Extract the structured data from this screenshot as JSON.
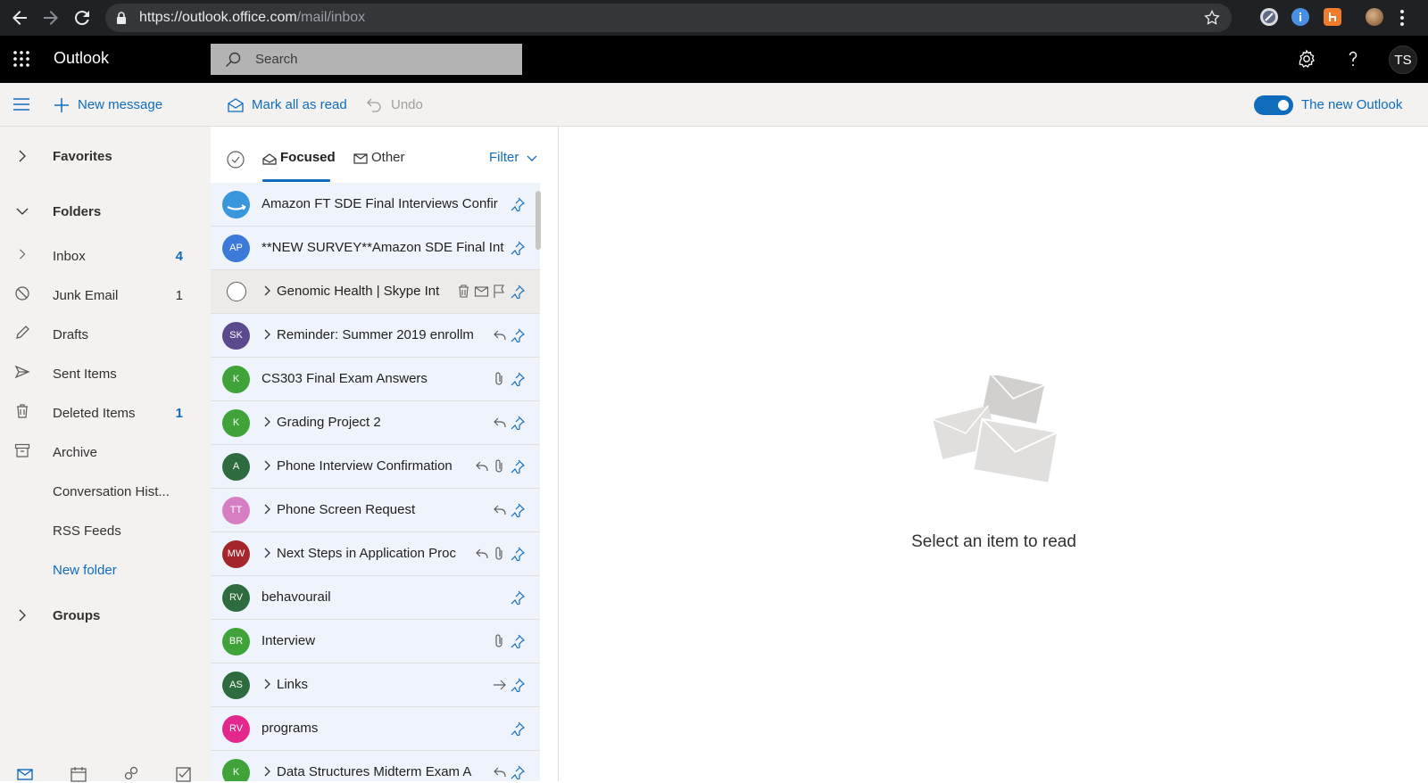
{
  "browser": {
    "url_host": "https://outlook.office.com",
    "url_path": "/mail/inbox"
  },
  "header": {
    "brand": "Outlook",
    "search_placeholder": "Search",
    "user_initials": "TS"
  },
  "commandbar": {
    "new_message": "New message",
    "mark_all_read": "Mark all as read",
    "undo": "Undo",
    "new_outlook_label": "The new Outlook",
    "new_outlook_on": true
  },
  "nav": {
    "favorites": "Favorites",
    "folders": "Folders",
    "items": [
      {
        "label": "Inbox",
        "count": "4"
      },
      {
        "label": "Junk Email",
        "count": "1"
      },
      {
        "label": "Drafts",
        "count": ""
      },
      {
        "label": "Sent Items",
        "count": ""
      },
      {
        "label": "Deleted Items",
        "count": "1"
      },
      {
        "label": "Archive",
        "count": ""
      },
      {
        "label": "Conversation Hist...",
        "count": ""
      },
      {
        "label": "RSS Feeds",
        "count": ""
      }
    ],
    "new_folder": "New folder",
    "groups": "Groups"
  },
  "list": {
    "tabs": [
      "Focused",
      "Other"
    ],
    "active_tab": "Focused",
    "filter": "Filter",
    "messages": [
      {
        "avatar": "",
        "avatar_color": "#3a96dd",
        "avatar_icon": "amazon-logo",
        "subject": "Amazon FT SDE Final Interviews Confir",
        "thread": false,
        "icons": [
          "pin"
        ]
      },
      {
        "avatar": "AP",
        "avatar_color": "#3c7ad9",
        "subject": "**NEW SURVEY**Amazon SDE Final Int",
        "thread": false,
        "icons": [
          "pin"
        ]
      },
      {
        "avatar": "",
        "avatar_color": "",
        "subject": "Genomic Health | Skype Int",
        "thread": true,
        "hover": true,
        "icons": [
          "delete",
          "mark-read",
          "flag",
          "pin"
        ]
      },
      {
        "avatar": "SK",
        "avatar_color": "#5c4a8f",
        "subject": "Reminder: Summer 2019 enrollm",
        "thread": true,
        "icons": [
          "reply",
          "pin"
        ]
      },
      {
        "avatar": "K",
        "avatar_color": "#3fa33a",
        "subject": "CS303 Final Exam Answers",
        "thread": false,
        "icons": [
          "attachment",
          "pin"
        ]
      },
      {
        "avatar": "K",
        "avatar_color": "#3fa33a",
        "subject": "Grading Project 2",
        "thread": true,
        "icons": [
          "reply",
          "pin"
        ]
      },
      {
        "avatar": "A",
        "avatar_color": "#2e6b3e",
        "subject": "Phone Interview Confirmation",
        "thread": true,
        "icons": [
          "reply",
          "attachment",
          "pin"
        ]
      },
      {
        "avatar": "TT",
        "avatar_color": "#d67ec4",
        "subject": "Phone Screen Request",
        "thread": true,
        "icons": [
          "reply",
          "pin"
        ]
      },
      {
        "avatar": "MW",
        "avatar_color": "#a4262c",
        "subject": "Next Steps in Application Proc",
        "thread": true,
        "icons": [
          "reply",
          "attachment",
          "pin"
        ]
      },
      {
        "avatar": "RV",
        "avatar_color": "#2e6b3e",
        "subject": "behavourail",
        "thread": false,
        "icons": [
          "pin"
        ]
      },
      {
        "avatar": "BR",
        "avatar_color": "#3fa33a",
        "subject": "Interview",
        "thread": false,
        "icons": [
          "attachment",
          "pin"
        ]
      },
      {
        "avatar": "AS",
        "avatar_color": "#2e6b3e",
        "subject": "Links",
        "thread": true,
        "icons": [
          "forward",
          "pin"
        ]
      },
      {
        "avatar": "RV",
        "avatar_color": "#e3278d",
        "subject": "programs",
        "thread": false,
        "icons": [
          "pin"
        ]
      },
      {
        "avatar": "K",
        "avatar_color": "#3fa33a",
        "subject": "Data Structures Midterm Exam A",
        "thread": true,
        "icons": [
          "reply",
          "pin"
        ]
      }
    ]
  },
  "reading": {
    "empty_text": "Select an item to read"
  },
  "colors": {
    "accent": "#0f6cbd",
    "topbar": "#000000",
    "unread_row": "#eff4fc"
  }
}
